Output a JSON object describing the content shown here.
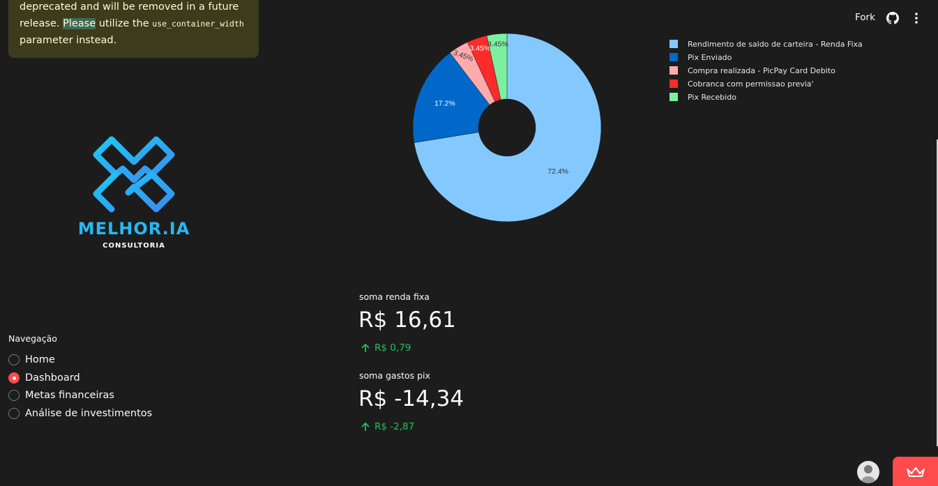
{
  "warning": {
    "line1": "deprecated and will be removed in a future",
    "line2_pre": "release. ",
    "line2_highlight": "Please",
    "line2_post": " utilize the ",
    "code": "use_container_width",
    "line3": "parameter instead."
  },
  "logo": {
    "title": "MELHOR.IA",
    "subtitle": "CONSULTORIA"
  },
  "navigation": {
    "title": "Navegação",
    "items": [
      {
        "label": "Home",
        "selected": false
      },
      {
        "label": "Dashboard",
        "selected": true
      },
      {
        "label": "Metas financeiras",
        "selected": false
      },
      {
        "label": "Análise de investimentos",
        "selected": false
      }
    ]
  },
  "header": {
    "fork_label": "Fork",
    "github_icon": "github-icon",
    "menu_icon": "kebab-menu-icon"
  },
  "chart_data": {
    "type": "pie",
    "hole": true,
    "categories": [
      "Rendimento de saldo de carteira - Renda Fixa",
      "Pix Enviado",
      "Compra realizada - PicPay Card Debito",
      "Cobranca com permissao previa'",
      "Pix Recebido"
    ],
    "values": [
      72.4,
      17.2,
      3.45,
      3.45,
      3.45
    ],
    "labels": [
      "72.4%",
      "17.2%",
      "3.45%",
      "3.45%",
      "3.45%"
    ],
    "colors": [
      "#83c9ff",
      "#0068c9",
      "#ffabab",
      "#ff2b2b",
      "#7defa1"
    ],
    "legend_position": "right"
  },
  "metrics": [
    {
      "label": "soma renda fixa",
      "value": "R$ 16,61",
      "delta": "R$ 0,79"
    },
    {
      "label": "soma gastos pix",
      "value": "R$ -14,34",
      "delta": "R$ -2,87"
    }
  ],
  "colors": {
    "accent": "#ff4b4b",
    "delta_positive": "#21c354",
    "background": "#1c1c1c"
  }
}
